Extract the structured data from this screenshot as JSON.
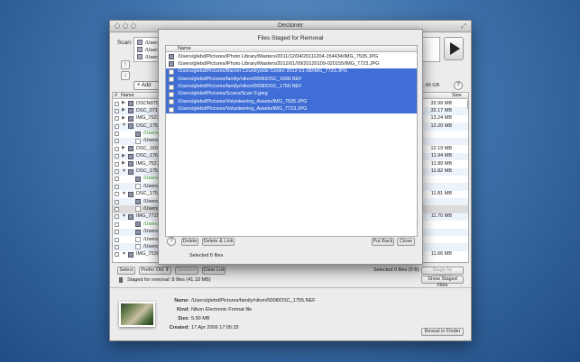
{
  "window": {
    "title": "Decloner"
  },
  "scan": {
    "label": "Scan:",
    "rows": [
      "/Users/",
      "/Users/",
      "/Users/"
    ],
    "add_label": "+ Add",
    "size_text": "1.48 GB",
    "help": "?"
  },
  "list": {
    "header": {
      "checkbox": "#",
      "name": "Name",
      "size": "Size"
    },
    "rows": [
      {
        "tri": "▶",
        "indent": 1,
        "icon": "folder",
        "name": "DSCN0791.",
        "size": "32.99 MB",
        "green": false
      },
      {
        "tri": "▶",
        "indent": 1,
        "icon": "folder",
        "name": "DSC_0717.",
        "size": "32.17 MB",
        "green": false
      },
      {
        "tri": "▶",
        "indent": 1,
        "icon": "folder",
        "name": "IMG_7523.",
        "size": "13.24 MB",
        "green": false
      },
      {
        "tri": "▼",
        "indent": 1,
        "icon": "folder",
        "name": "DSC_1753.",
        "size": "12.20 MB",
        "green": false
      },
      {
        "tri": "",
        "indent": 2,
        "icon": "image",
        "name": "/Users/g",
        "size": "",
        "green": true
      },
      {
        "tri": "",
        "indent": 2,
        "icon": "doc",
        "name": "/Users/g",
        "size": "",
        "green": false
      },
      {
        "tri": "▶",
        "indent": 1,
        "icon": "folder",
        "name": "DSC_1699.",
        "size": "12.19 MB",
        "green": false
      },
      {
        "tri": "▶",
        "indent": 1,
        "icon": "folder",
        "name": "DSC_1762.",
        "size": "11.94 MB",
        "green": false
      },
      {
        "tri": "▶",
        "indent": 1,
        "icon": "folder",
        "name": "IMG_7527.",
        "size": "11.89 MB",
        "green": false
      },
      {
        "tri": "▼",
        "indent": 1,
        "icon": "folder",
        "name": "DSC_1754.",
        "size": "11.82 MB",
        "green": false
      },
      {
        "tri": "",
        "indent": 2,
        "icon": "image",
        "name": "/Users/g",
        "size": "",
        "green": true
      },
      {
        "tri": "",
        "indent": 2,
        "icon": "doc",
        "name": "/Users/g",
        "size": "",
        "green": false
      },
      {
        "tri": "▼",
        "indent": 1,
        "icon": "folder",
        "name": "DSC_1755.",
        "size": "11.81 MB",
        "green": false
      },
      {
        "tri": "",
        "indent": 2,
        "icon": "image",
        "name": "/Users/g",
        "size": "",
        "green": false
      },
      {
        "tri": "",
        "indent": 2,
        "icon": "doc",
        "name": "/Users/g",
        "size": "",
        "green": false
      },
      {
        "tri": "▼",
        "indent": 1,
        "icon": "folder",
        "name": "IMG_7725.",
        "size": "11.70 MB",
        "green": false
      },
      {
        "tri": "",
        "indent": 2,
        "icon": "image",
        "name": "/Users/g",
        "size": "",
        "green": true
      },
      {
        "tri": "",
        "indent": 2,
        "icon": "image",
        "name": "/Users/g",
        "size": "",
        "green": false
      },
      {
        "tri": "",
        "indent": 2,
        "icon": "doc",
        "name": "/Users/g",
        "size": "",
        "green": false
      },
      {
        "tri": "",
        "indent": 2,
        "icon": "doc",
        "name": "/Users/g",
        "size": "",
        "green": false
      },
      {
        "tri": "▼",
        "indent": 1,
        "icon": "folder",
        "name": "IMG_7539.",
        "size": "11.66 MB",
        "green": false
      }
    ]
  },
  "bottom_bar": {
    "select": "Select",
    "prefer": "Prefer Old",
    "deselect": "Deselect",
    "clear": "Clear List",
    "status": "Selected 0 files (0 B)",
    "stage": "Stage for Removal"
  },
  "staged": {
    "text": "Staged for removal: 8 files (41.18 MB)",
    "show_button": "Show Staged Files"
  },
  "info": {
    "name_label": "Name:",
    "name_value": "/Users/glebd/Pictures/family/nikon/0008/DSC_1755.NEF",
    "kind_label": "Kind:",
    "kind_value": "Nikon Electronic Format file",
    "size_label": "Size:",
    "size_value": "5.90 MB",
    "created_label": "Created:",
    "created_value": "17 Apr 2006 17:05:33",
    "reveal_button": "Reveal in Finder"
  },
  "sheet": {
    "title": "Files Staged for Removal",
    "header_name": "Name",
    "rows": [
      {
        "path": "/Users/glebd/Pictures/iPhoto Library/Masters/2011/12/04/20111204-154434/IMG_7535.JPG",
        "selected": false,
        "icon": "image"
      },
      {
        "path": "/Users/glebd/Pictures/iPhoto Library/Masters/2012/01/09/20120109-020155/IMG_7723.JPG",
        "selected": false,
        "icon": "image"
      },
      {
        "path": "/Users/glebd/Pictures/Barnet Countryside Centre 2012-01-08/IMG_7723.JPG",
        "selected": true,
        "icon": "doc"
      },
      {
        "path": "/Users/glebd/Pictures/family/nikon/0006/DSC_1698.NEF",
        "selected": true,
        "icon": "doc"
      },
      {
        "path": "/Users/glebd/Pictures/family/nikon/0008/DSC_1756.NEF",
        "selected": true,
        "icon": "doc"
      },
      {
        "path": "/Users/glebd/Pictures/Scans/Scan 9.jpeg",
        "selected": true,
        "icon": "doc"
      },
      {
        "path": "/Users/glebd/Pictures/Volunteering_Assets/IMG_7535.JPG",
        "selected": true,
        "icon": "doc"
      },
      {
        "path": "/Users/glebd/Pictures/Volunteering_Assets/IMG_7723.JPG",
        "selected": true,
        "icon": "doc"
      }
    ],
    "help": "?",
    "delete": "Delete",
    "delete_link": "Delete & Link",
    "put_back": "Put Back",
    "close": "Close",
    "status": "Selected 6 files"
  }
}
